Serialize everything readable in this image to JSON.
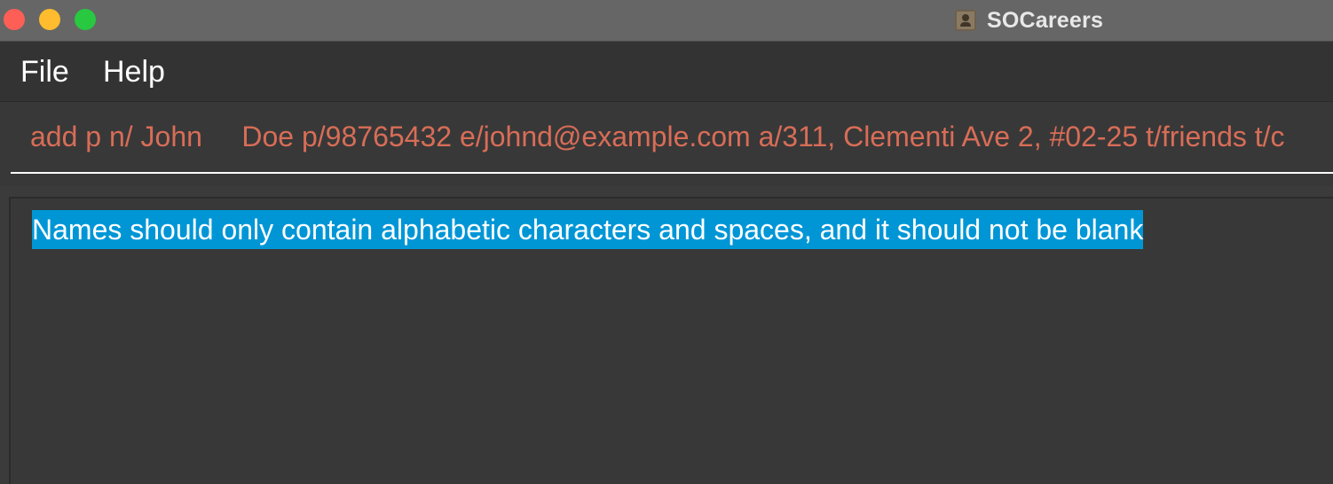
{
  "window": {
    "title": "SOCareers",
    "app_icon": "contacts-book-icon",
    "buttons": {
      "close_color": "#fd5f57",
      "minimize_color": "#febc2e",
      "zoom_color": "#28c840"
    }
  },
  "menubar": {
    "items": [
      {
        "label": "File"
      },
      {
        "label": "Help"
      }
    ]
  },
  "command_box": {
    "value": "add p n/ John     Doe p/98765432 e/johnd@example.com a/311, Clementi Ave 2, #02-25 t/friends t/c",
    "text_color": "#d86d57"
  },
  "result_display": {
    "message": "Names should only contain alphabetic characters and spaces, and it should not be blank",
    "highlight_color": "#0096d6"
  }
}
